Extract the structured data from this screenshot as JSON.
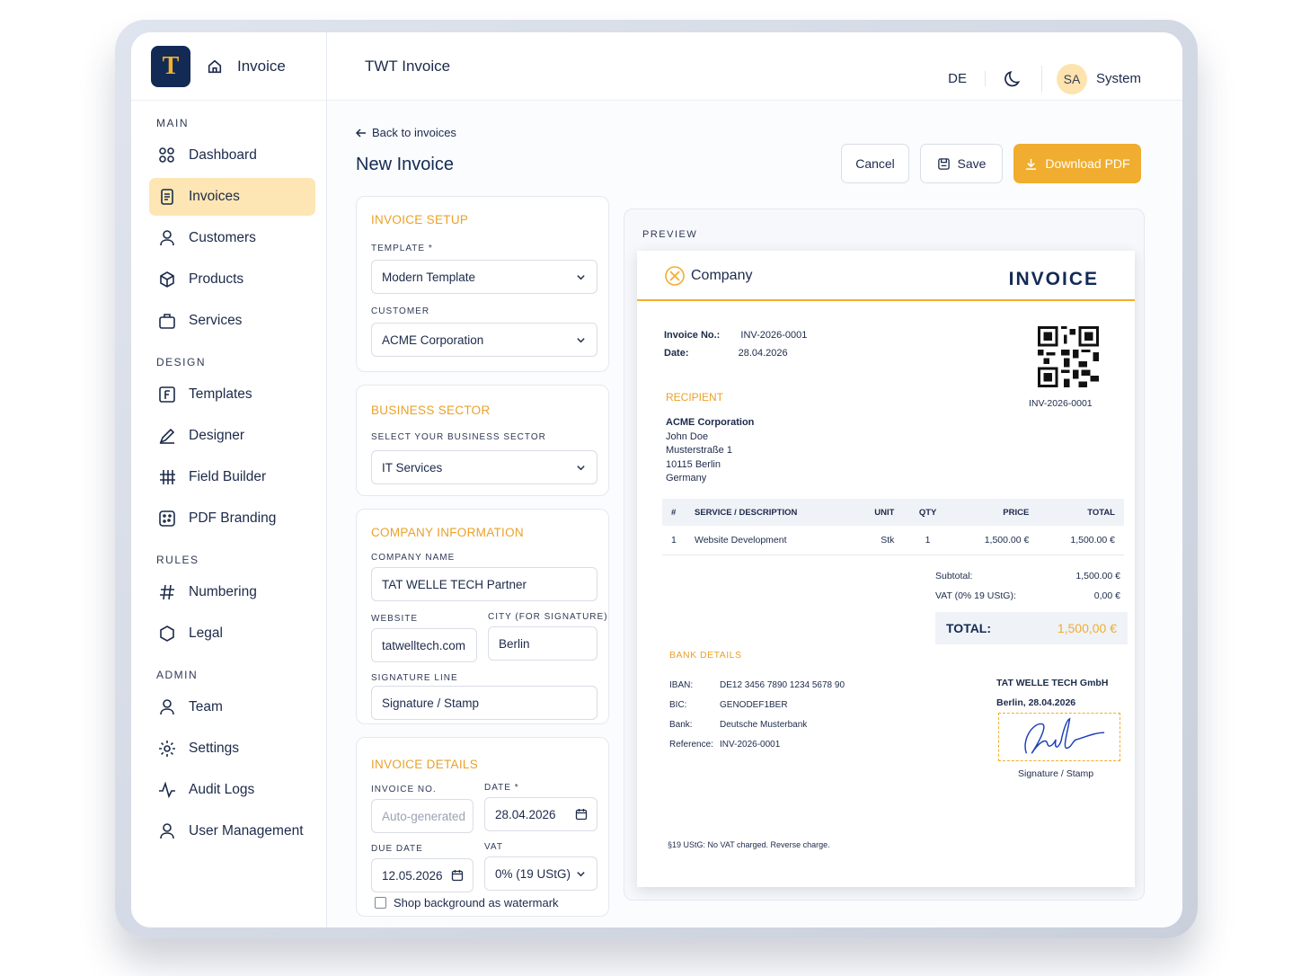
{
  "app": {
    "logo_letter": "T",
    "title": "Invoice",
    "window_title": "TWT Invoice"
  },
  "top": {
    "lang": "DE",
    "avatar": "SA",
    "user": "System"
  },
  "sidebar": {
    "sections": [
      {
        "title": "MAIN",
        "items": [
          "Dashboard",
          "Invoices",
          "Customers",
          "Products",
          "Services"
        ]
      },
      {
        "title": "DESIGN",
        "items": [
          "Templates",
          "Designer",
          "Field Builder",
          "PDF Branding"
        ]
      },
      {
        "title": "RULES",
        "items": [
          "Numbering",
          "Legal"
        ]
      },
      {
        "title": "ADMIN",
        "items": [
          "Team",
          "Settings",
          "Audit Logs",
          "User Management"
        ]
      }
    ],
    "active": "Invoices"
  },
  "main": {
    "back": "Back to invoices",
    "title": "New Invoice",
    "buttons": {
      "cancel": "Cancel",
      "save": "Save",
      "pdf": "Download PDF"
    }
  },
  "form": {
    "setup": {
      "heading": "INVOICE SETUP",
      "template_label": "TEMPLATE *",
      "template": "Modern Template",
      "customer_label": "CUSTOMER",
      "customer": "ACME Corporation"
    },
    "sector": {
      "heading": "BUSINESS SECTOR",
      "label": "SELECT YOUR BUSINESS SECTOR",
      "value": "IT Services"
    },
    "company": {
      "heading": "COMPANY INFORMATION",
      "name_label": "COMPANY NAME",
      "name": "TAT WELLE TECH Partner",
      "website_label": "WEBSITE",
      "website": "tatwelltech.com",
      "city_label": "CITY (FOR SIGNATURE)",
      "city": "Berlin",
      "sig_label": "SIGNATURE LINE",
      "sig": "Signature / Stamp"
    },
    "details": {
      "heading": "INVOICE DETAILS",
      "no_label": "INVOICE NO.",
      "no_placeholder": "Auto-generated",
      "date_label": "DATE *",
      "date": "28.04.2026",
      "due_label": "DUE DATE",
      "due": "12.05.2026",
      "vat_label": "VAT",
      "vat": "0% (19 UStG)",
      "watermark": "Shop background as watermark"
    }
  },
  "preview": {
    "label": "PREVIEW",
    "company": "Company",
    "heading": "INVOICE",
    "no_label": "Invoice No.:",
    "no": "INV-2026-0001",
    "date_label": "Date:",
    "date": "28.04.2026",
    "qr_caption": "INV-2026-0001",
    "recipient_heading": "RECIPIENT",
    "recipient": {
      "name": "ACME Corporation",
      "contact": "John Doe",
      "street": "Musterstraße 1",
      "city": "10115 Berlin",
      "country": "Germany"
    },
    "table": {
      "headers": [
        "#",
        "SERVICE / DESCRIPTION",
        "UNIT",
        "QTY",
        "PRICE",
        "TOTAL"
      ],
      "rows": [
        [
          "1",
          "Website Development",
          "Stk",
          "1",
          "1,500.00 €",
          "1,500.00 €"
        ]
      ]
    },
    "subtotal_label": "Subtotal:",
    "subtotal": "1,500.00 €",
    "vat_label": "VAT (0% 19 UStG):",
    "vat": "0,00 €",
    "total_label": "TOTAL:",
    "total": "1,500,00 €",
    "bank_heading": "BANK DETAILS",
    "bank": [
      {
        "k": "IBAN:",
        "v": "DE12 3456 7890 1234 5678 90"
      },
      {
        "k": "BIC:",
        "v": "GENODEF1BER"
      },
      {
        "k": "Bank:",
        "v": "Deutsche Musterbank"
      },
      {
        "k": "Reference:",
        "v": "INV-2026-0001"
      }
    ],
    "sig_company": "TAT WELLE TECH GmbH",
    "sig_place": "Berlin, 28.04.2026",
    "sig_caption": "Signature / Stamp",
    "footer": "§19 UStG: No VAT charged. Reverse charge."
  },
  "colors": {
    "accent": "#F1AD2F",
    "navy": "#132A55",
    "active_bg": "#FDE6B4"
  }
}
